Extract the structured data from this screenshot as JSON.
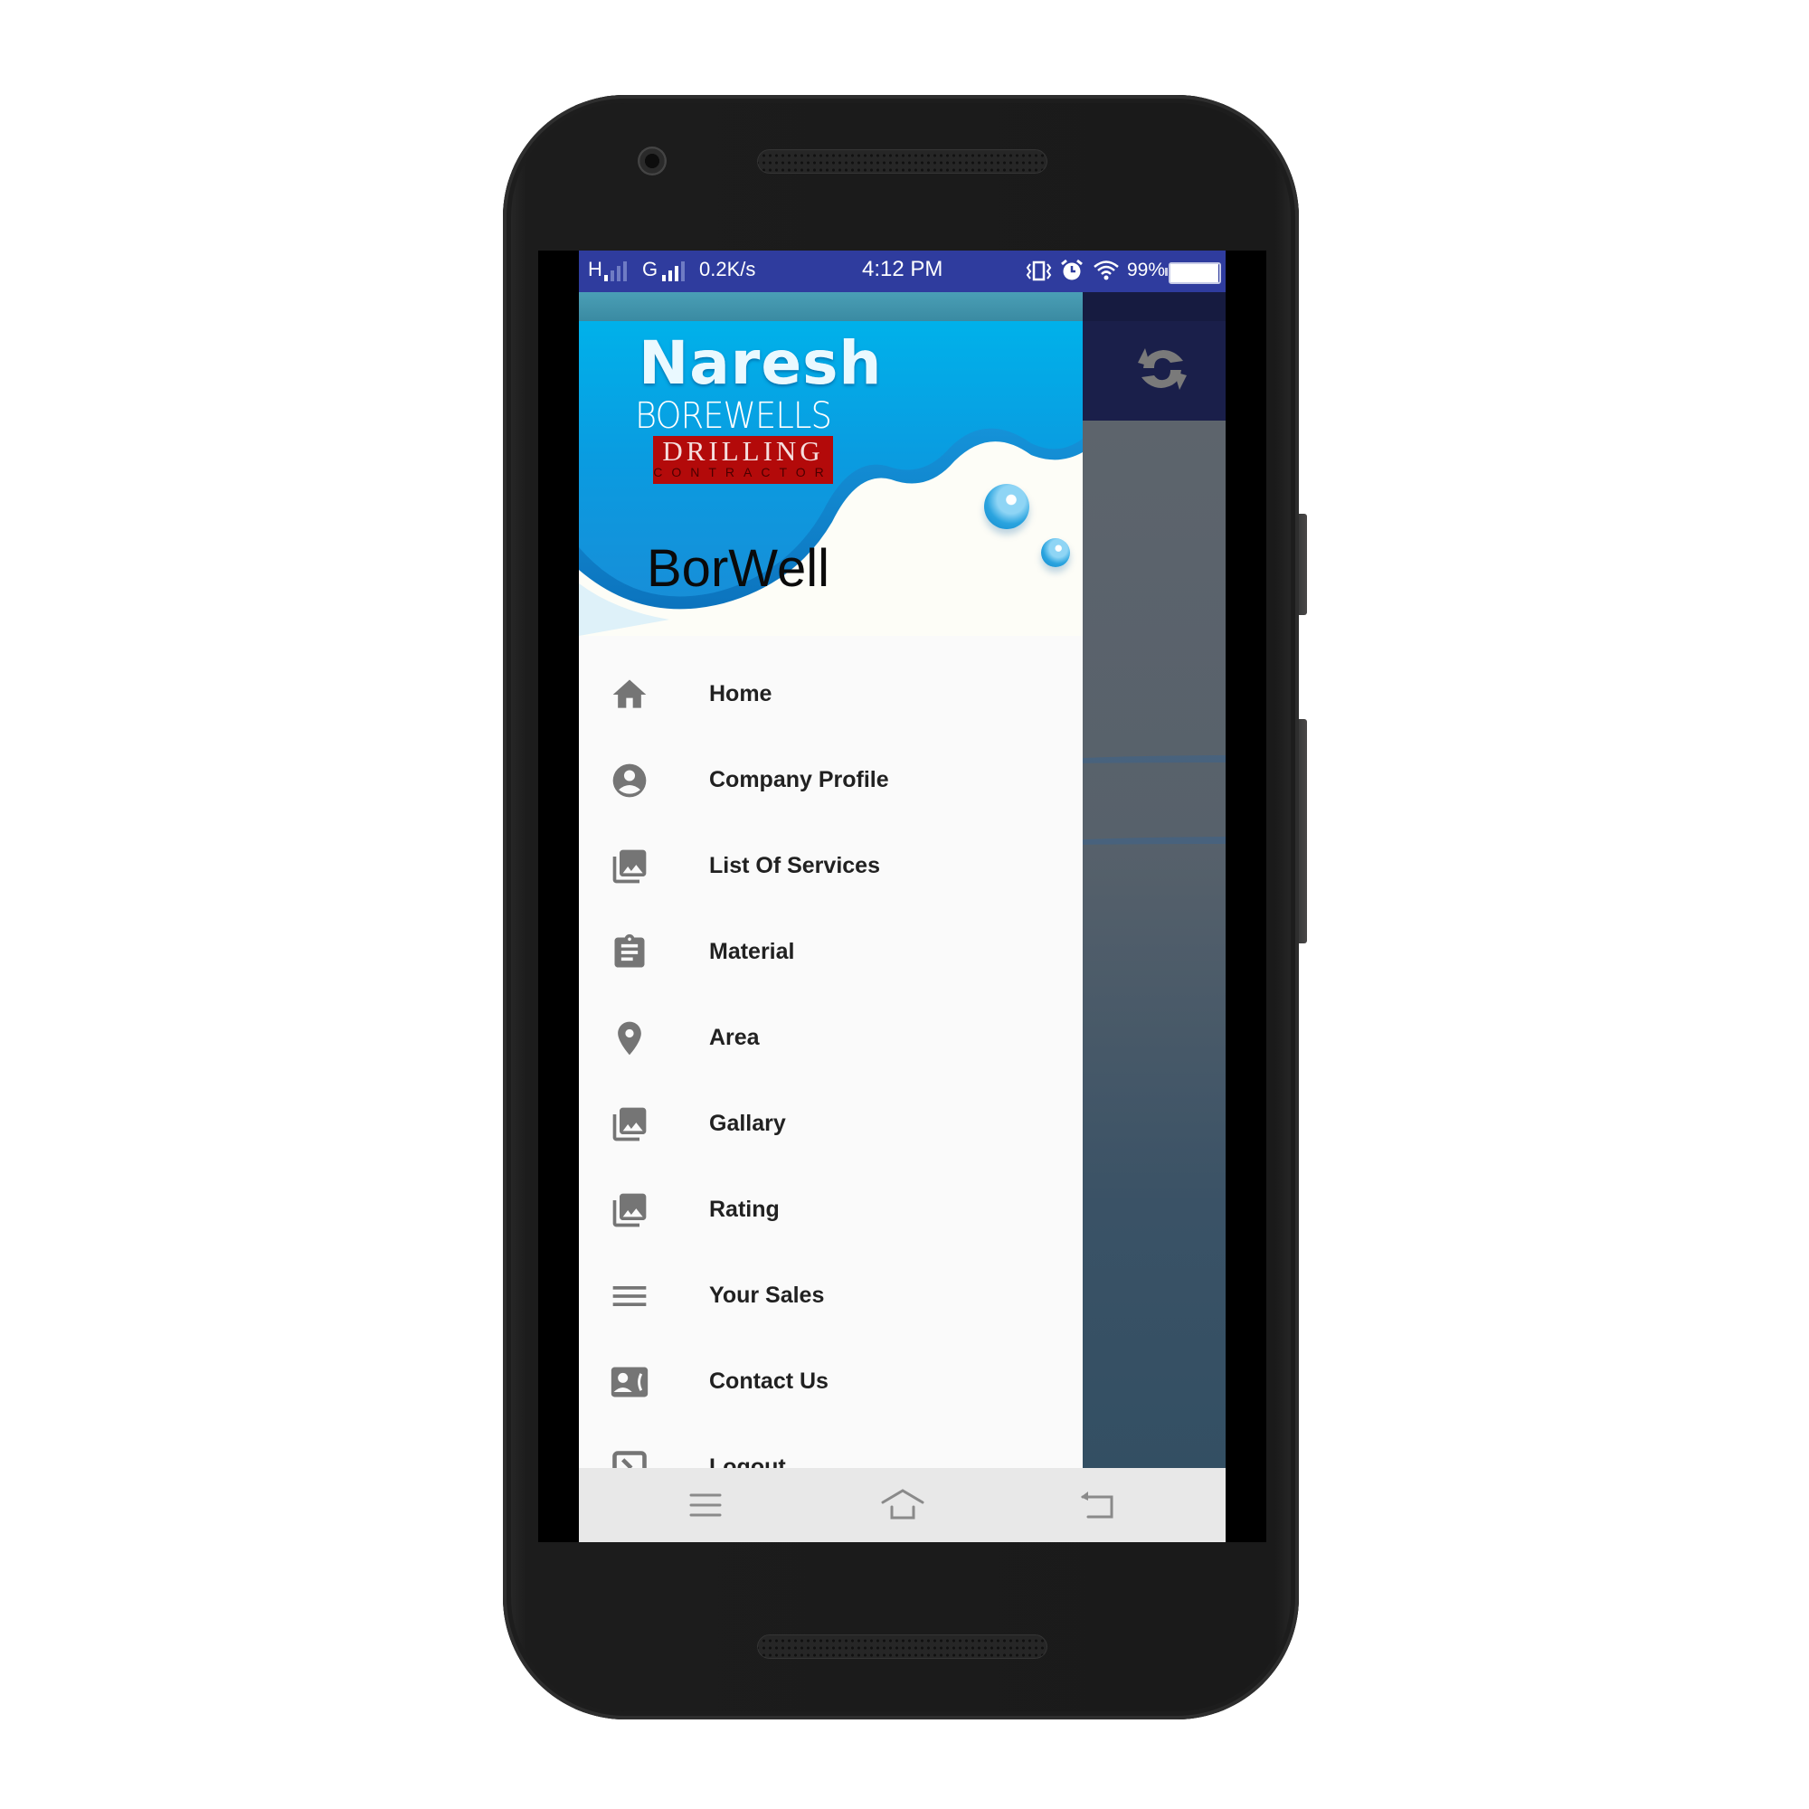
{
  "status_bar": {
    "network_1": "H",
    "network_2": "G",
    "data_speed": "0.2K/s",
    "time": "4:12 PM",
    "battery_percent": "99%",
    "battery_level": 0.99,
    "icons": [
      "signal-h-icon",
      "signal-g-icon",
      "vibrate-icon",
      "alarm-icon",
      "wifi-icon",
      "battery-icon"
    ]
  },
  "app": {
    "toolbar_action_icon": "refresh-icon"
  },
  "drawer": {
    "header": {
      "logo_line1": "Naresh",
      "logo_line2": "BOREWELLS",
      "logo_line3": "DRILLING",
      "logo_line4": "CONTRACTOR",
      "app_name": "BorWell"
    },
    "items": [
      {
        "label": "Home",
        "icon": "home-icon"
      },
      {
        "label": "Company Profile",
        "icon": "account-circle-icon"
      },
      {
        "label": "List Of Services",
        "icon": "photo-library-icon"
      },
      {
        "label": "Material",
        "icon": "clipboard-icon"
      },
      {
        "label": "Area",
        "icon": "location-pin-icon"
      },
      {
        "label": "Gallary",
        "icon": "photo-library-icon"
      },
      {
        "label": "Rating",
        "icon": "photo-library-icon"
      },
      {
        "label": "Your Sales",
        "icon": "list-icon"
      },
      {
        "label": "Contact Us",
        "icon": "contact-phone-icon"
      },
      {
        "label": "Logout",
        "icon": "logout-icon"
      }
    ]
  },
  "nav_bar": {
    "buttons": [
      "menu-icon",
      "home-icon",
      "back-icon"
    ]
  },
  "colors": {
    "status_bar": "#2f3c9e",
    "toolbar": "#1a1f4a",
    "icon_gray": "#757575",
    "drawer_bg": "#fafafa",
    "logo_red": "#b30a0a"
  }
}
